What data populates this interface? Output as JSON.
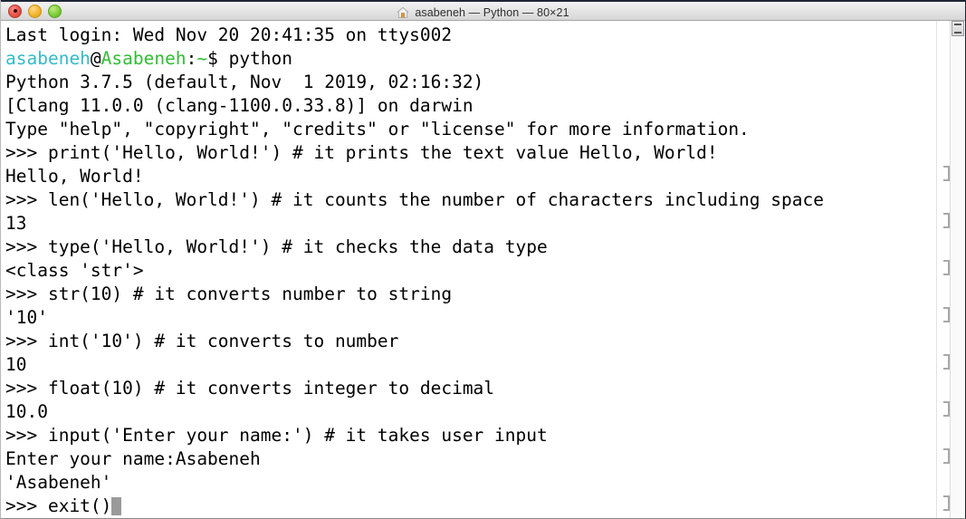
{
  "window": {
    "title": "asabeneh — Python — 80×21",
    "icon": "home-icon",
    "traffic_lights": [
      {
        "name": "close-button",
        "color": "#e8554b"
      },
      {
        "name": "minimize-button",
        "color": "#f2b52e"
      },
      {
        "name": "maximize-button",
        "color": "#7ece3d"
      }
    ]
  },
  "terminal": {
    "prompt_symbol": ">>> ",
    "shell_prompt": {
      "user": "asabeneh",
      "at": "@",
      "host": "Asabeneh",
      "colon": ":",
      "tilde": "~",
      "dollar_cmd": "$ python",
      "user_color": "#33bbc8",
      "host_color": "#2fbf32"
    },
    "lines": [
      {
        "type": "plain",
        "text": "Last login: Wed Nov 20 20:41:35 on ttys002"
      },
      {
        "type": "prompt_shell",
        "text": "asabeneh@Asabeneh:~$ python"
      },
      {
        "type": "plain",
        "text": "Python 3.7.5 (default, Nov  1 2019, 02:16:32)"
      },
      {
        "type": "plain",
        "text": "[Clang 11.0.0 (clang-1100.0.33.8)] on darwin"
      },
      {
        "type": "plain",
        "text": "Type \"help\", \"copyright\", \"credits\" or \"license\" for more information."
      },
      {
        "type": "input",
        "text": ">>> print('Hello, World!') # it prints the text value Hello, World!"
      },
      {
        "type": "output",
        "text": "Hello, World!"
      },
      {
        "type": "input",
        "text": ">>> len('Hello, World!') # it counts the number of characters including space"
      },
      {
        "type": "output",
        "text": "13"
      },
      {
        "type": "input",
        "text": ">>> type('Hello, World!') # it checks the data type"
      },
      {
        "type": "output",
        "text": "<class 'str'>"
      },
      {
        "type": "input",
        "text": ">>> str(10) # it converts number to string"
      },
      {
        "type": "output",
        "text": "'10'"
      },
      {
        "type": "input",
        "text": ">>> int('10') # it converts to number"
      },
      {
        "type": "output",
        "text": "10"
      },
      {
        "type": "input",
        "text": ">>> float(10) # it converts integer to decimal"
      },
      {
        "type": "output",
        "text": "10.0"
      },
      {
        "type": "input",
        "text": ">>> input('Enter your name:') # it takes user input"
      },
      {
        "type": "output",
        "text": "Enter your name:Asabeneh"
      },
      {
        "type": "output",
        "text": "'Asabeneh'"
      },
      {
        "type": "input_cursor",
        "text": ">>> exit()"
      }
    ],
    "text_color": "#000000",
    "background": "#ffffff",
    "cursor_color": "#9a9a9a"
  },
  "scrollbar": {
    "thumb_name": "scrollbar-thumb",
    "prompt_mark_rows": [
      5,
      7,
      9,
      11,
      13,
      15,
      17,
      20
    ]
  }
}
